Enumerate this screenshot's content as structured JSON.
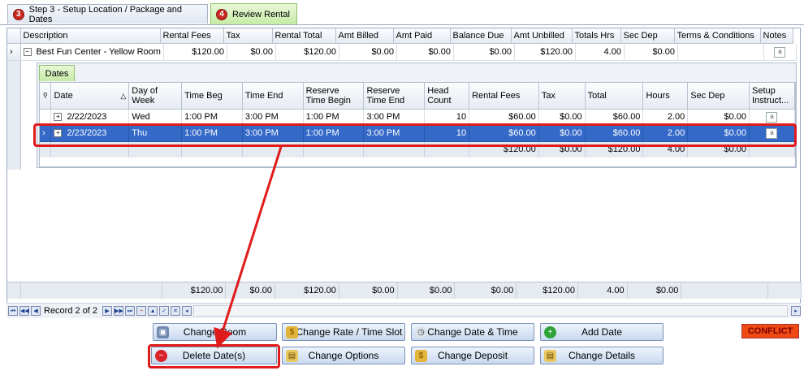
{
  "tabs": [
    {
      "badge": "3",
      "label": "Step 3 - Setup Location / Package and Dates"
    },
    {
      "badge": "4",
      "label": "Review Rental"
    }
  ],
  "master": {
    "columns": [
      "Description",
      "Rental Fees",
      "Tax",
      "Rental Total",
      "Amt Billed",
      "Amt Paid",
      "Balance Due",
      "Amt Unbilled",
      "Totals Hrs",
      "Sec Dep",
      "Terms & Conditions",
      "Notes"
    ],
    "row": {
      "description": "Best Fun Center - Yellow Room",
      "rental_fees": "$120.00",
      "tax": "$0.00",
      "rental_total": "$120.00",
      "amt_billed": "$0.00",
      "amt_paid": "$0.00",
      "balance_due": "$0.00",
      "amt_unbilled": "$120.00",
      "totals_hrs": "4.00",
      "sec_dep": "$0.00",
      "terms": ""
    },
    "footer": {
      "rental_fees": "$120.00",
      "tax": "$0.00",
      "rental_total": "$120.00",
      "amt_billed": "$0.00",
      "amt_paid": "$0.00",
      "balance_due": "$0.00",
      "amt_unbilled": "$120.00",
      "totals_hrs": "4.00",
      "sec_dep": "$0.00"
    }
  },
  "detail": {
    "tab_label": "Dates",
    "columns": [
      "Date",
      "Day of Week",
      "Time Beg",
      "Time End",
      "Reserve Time Begin",
      "Reserve Time End",
      "Head Count",
      "Rental Fees",
      "Tax",
      "Total",
      "Hours",
      "Sec Dep",
      "Setup Instruct..."
    ],
    "rows": [
      {
        "date": "2/22/2023",
        "day": "Wed",
        "time_beg": "1:00 PM",
        "time_end": "3:00 PM",
        "res_begin": "1:00 PM",
        "res_end": "3:00 PM",
        "head_count": "10",
        "rental_fees": "$60.00",
        "tax": "$0.00",
        "total": "$60.00",
        "hours": "2.00",
        "sec_dep": "$0.00"
      },
      {
        "date": "2/23/2023",
        "day": "Thu",
        "time_beg": "1:00 PM",
        "time_end": "3:00 PM",
        "res_begin": "1:00 PM",
        "res_end": "3:00 PM",
        "head_count": "10",
        "rental_fees": "$60.00",
        "tax": "$0.00",
        "total": "$60.00",
        "hours": "2.00",
        "sec_dep": "$0.00"
      }
    ],
    "footer": {
      "rental_fees": "$120.00",
      "tax": "$0.00",
      "total": "$120.00",
      "hours": "4.00",
      "sec_dep": "$0.00"
    }
  },
  "navigator": {
    "record_text": "Record 2 of 2"
  },
  "buttons": {
    "change_room": "Change Room",
    "change_rate": "Change Rate / Time Slot",
    "change_date_time": "Change Date & Time",
    "add_date": "Add Date",
    "delete_dates": "Delete Date(s)",
    "change_options": "Change Options",
    "change_deposit": "Change Deposit",
    "change_details": "Change Details"
  },
  "conflict_label": "CONFLICT",
  "colors": {
    "selection": "#3569c8",
    "highlight": "#e01b1b",
    "conflict": "#f04a14",
    "tab_active": "#c6eba6"
  }
}
